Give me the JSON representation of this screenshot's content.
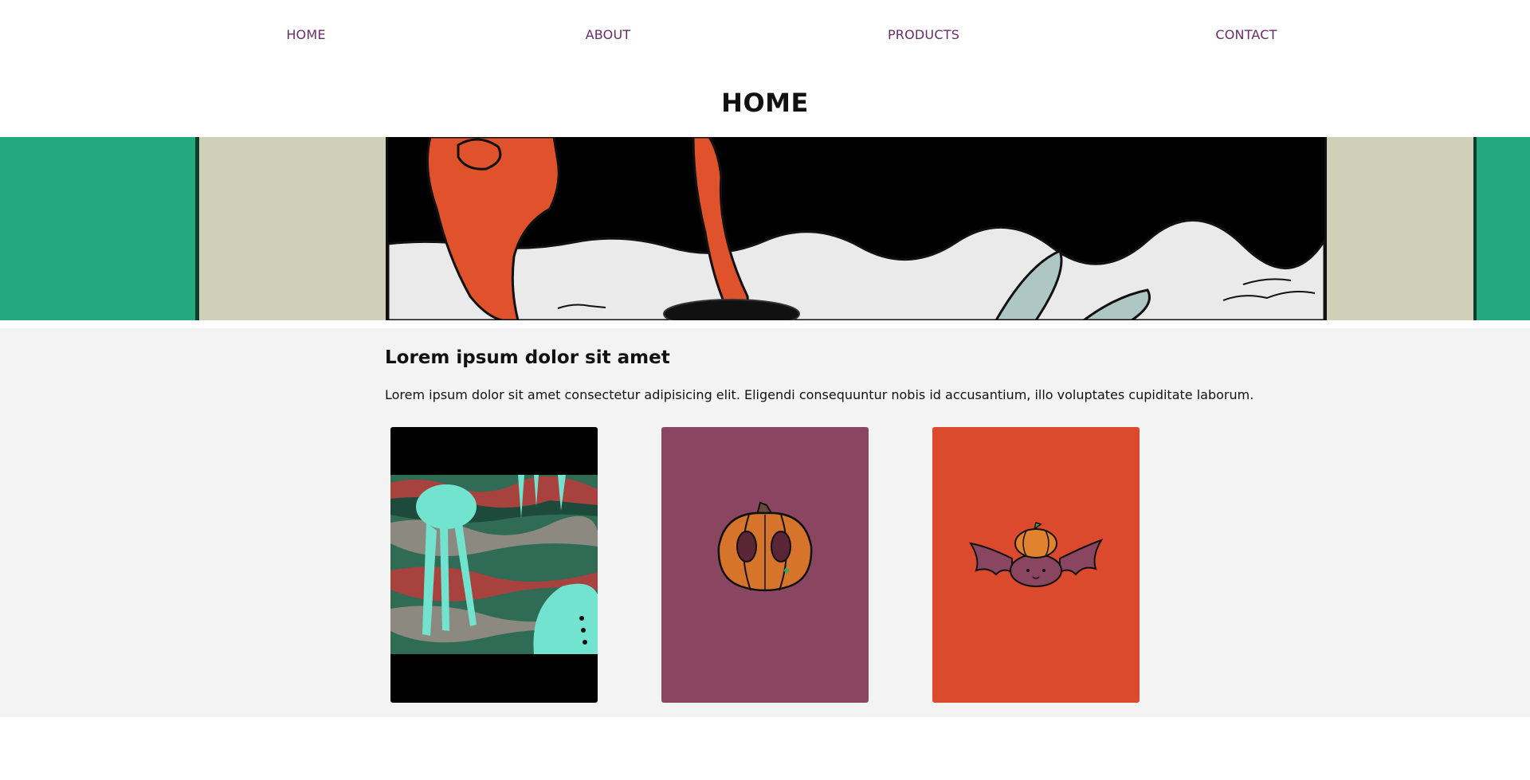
{
  "nav": {
    "items": [
      {
        "label": "HOME"
      },
      {
        "label": "ABOUT"
      },
      {
        "label": "PRODUCTS"
      },
      {
        "label": "CONTACT"
      }
    ]
  },
  "page": {
    "title": "HOME"
  },
  "hero": {
    "image_name": "hero-illustration"
  },
  "section": {
    "heading": "Lorem ipsum dolor sit amet",
    "body": "Lorem ipsum dolor sit amet consectetur adipisicing elit. Eligendi consequuntur nobis id accusantium, illo voluptates cupiditate laborum.",
    "cards": [
      {
        "image": "jellyfish-creatures-illustration",
        "background": "#000000"
      },
      {
        "image": "pumpkin-illustration",
        "background": "#8a4560"
      },
      {
        "image": "pumpkin-bat-illustration",
        "background": "#db4a2d"
      }
    ]
  },
  "colors": {
    "nav_link": "#6b2a6b",
    "section_bg": "#f3f3f3",
    "hero_green": "#22a97e",
    "hero_beige": "#d0cfb8",
    "hero_orange": "#e0522b"
  }
}
